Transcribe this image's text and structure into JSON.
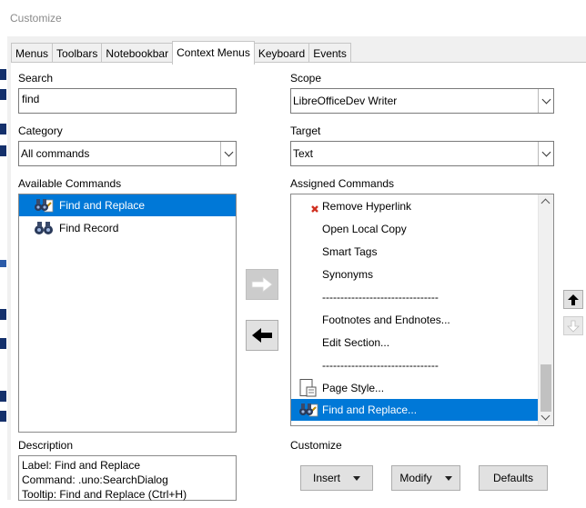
{
  "window": {
    "title": "Customize"
  },
  "tabs": [
    "Menus",
    "Toolbars",
    "Notebookbar",
    "Context Menus",
    "Keyboard",
    "Events"
  ],
  "active_tab": "Context Menus",
  "search": {
    "label": "Search",
    "value": "find"
  },
  "category": {
    "label": "Category",
    "value": "All commands"
  },
  "available": {
    "label": "Available Commands",
    "items": [
      {
        "label": "Find and Replace",
        "icon": "binoculars-icon",
        "selected": true
      },
      {
        "label": "Find Record",
        "icon": "binoculars-icon",
        "selected": false
      }
    ]
  },
  "scope": {
    "label": "Scope",
    "value": "LibreOfficeDev Writer"
  },
  "target": {
    "label": "Target",
    "value": "Text"
  },
  "assigned": {
    "label": "Assigned Commands",
    "items": [
      {
        "label": "Remove Hyperlink",
        "icon": "remove-hyperlink-icon"
      },
      {
        "label": "Open Local Copy",
        "icon": ""
      },
      {
        "label": "Smart Tags",
        "icon": ""
      },
      {
        "label": "Synonyms",
        "icon": ""
      },
      {
        "label": "--------------------------------",
        "icon": ""
      },
      {
        "label": "Footnotes and Endnotes...",
        "icon": ""
      },
      {
        "label": "Edit Section...",
        "icon": ""
      },
      {
        "label": "--------------------------------",
        "icon": ""
      },
      {
        "label": "Page Style...",
        "icon": "page-style-icon"
      },
      {
        "label": "Find and Replace...",
        "icon": "binoculars-icon",
        "selected": true
      }
    ]
  },
  "description": {
    "label": "Description",
    "lines": [
      "Label: Find and Replace",
      "Command: .uno:SearchDialog",
      "Tooltip: Find and Replace (Ctrl+H)"
    ]
  },
  "customize": {
    "label": "Customize",
    "insert": "Insert",
    "modify": "Modify",
    "defaults": "Defaults"
  },
  "colors": {
    "selection": "#0078d7",
    "dialog_bg": "#f0f0f0",
    "disabled_arrow": "#ffffff"
  }
}
